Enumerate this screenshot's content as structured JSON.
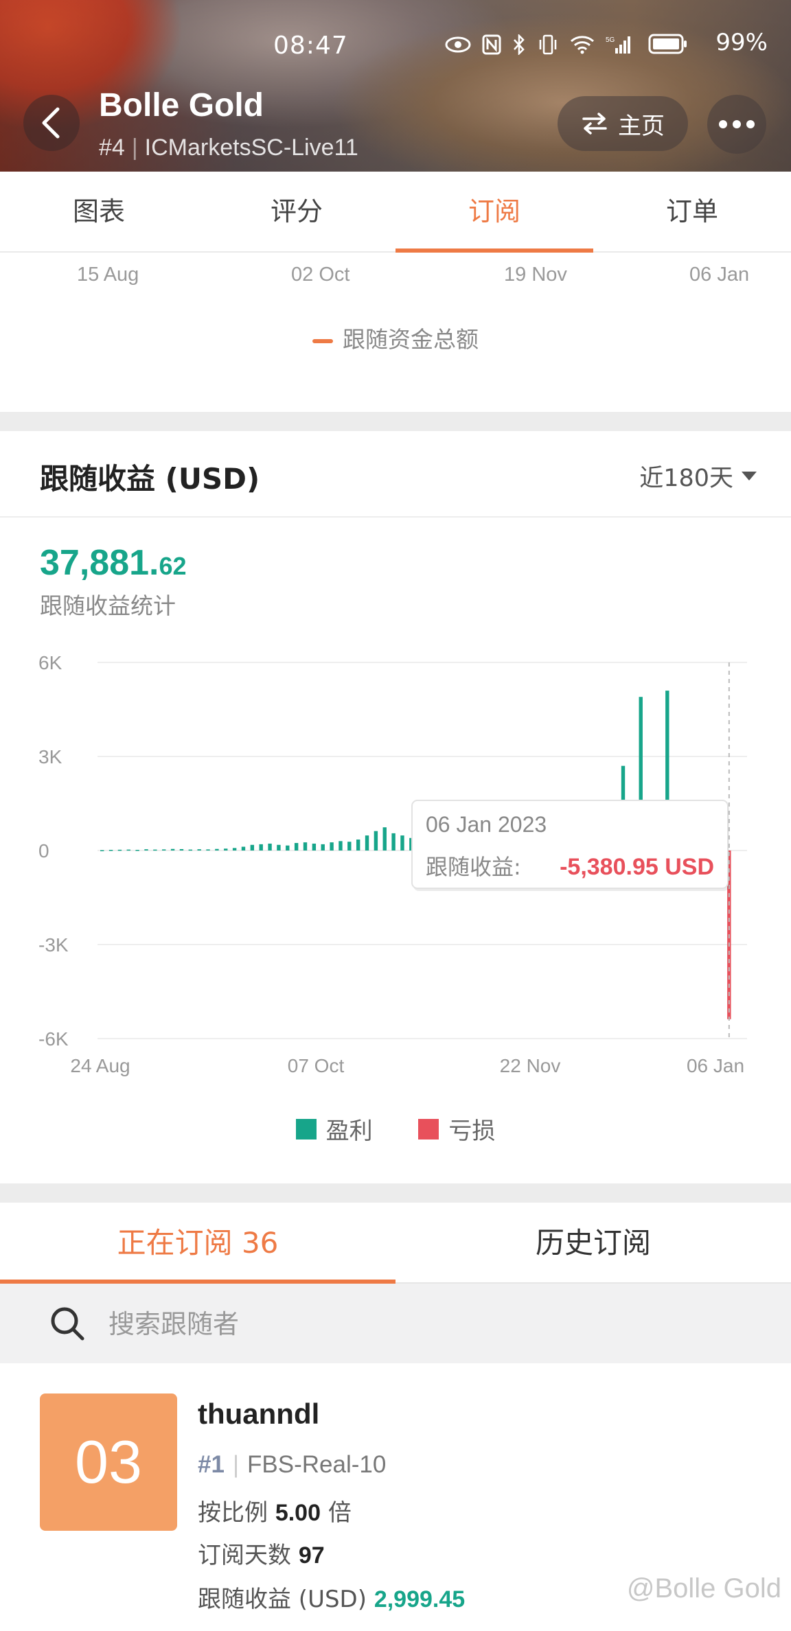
{
  "status_bar": {
    "time": "08:47",
    "battery": "99%",
    "network": "5G"
  },
  "header": {
    "title": "Bolle Gold",
    "rank": "#4",
    "server": "ICMarketsSC-Live11",
    "home_label": "主页"
  },
  "top_tabs": [
    "图表",
    "评分",
    "订阅",
    "订单"
  ],
  "top_tabs_active": "订阅",
  "previous_chart": {
    "x_ticks": [
      "15 Aug",
      "02 Oct",
      "19 Nov",
      "06 Jan"
    ],
    "legend": "跟随资金总额"
  },
  "profit_section": {
    "title": "跟随收益 (USD)",
    "range": "近180天",
    "value_int": "37,881.",
    "value_dec": "62",
    "value_label": "跟随收益统计",
    "tooltip": {
      "date": "06 Jan 2023",
      "label": "跟随收益:",
      "value": "-5,380.95 USD"
    },
    "legend": {
      "profit": "盈利",
      "loss": "亏损"
    }
  },
  "chart_data": {
    "type": "bar",
    "ylim": [
      -6000,
      6000
    ],
    "y_ticks": [
      "6K",
      "3K",
      "0",
      "-3K",
      "-6K"
    ],
    "x_ticks": [
      "24 Aug",
      "07 Oct",
      "22 Nov",
      "06 Jan"
    ],
    "series": [
      {
        "name": "盈利",
        "color": "#17a58a",
        "values": [
          10,
          20,
          25,
          30,
          20,
          40,
          30,
          35,
          50,
          45,
          30,
          40,
          35,
          50,
          60,
          80,
          120,
          180,
          200,
          220,
          180,
          160,
          240,
          260,
          220,
          200,
          260,
          300,
          280,
          350,
          480,
          620,
          740,
          550,
          480,
          400,
          380,
          420,
          460,
          500,
          440,
          520,
          560,
          600,
          500,
          450,
          520,
          580,
          620,
          680,
          600,
          550,
          700,
          760,
          820,
          680,
          900,
          1200,
          1000,
          2700,
          1400,
          4900,
          600,
          400,
          5100,
          600,
          800,
          400,
          900,
          1100,
          800
        ]
      },
      {
        "name": "亏损",
        "color": "#e8505b",
        "values": [
          -5380.95
        ]
      }
    ],
    "colors": {
      "profit": "#17a58a",
      "loss": "#e8505b"
    }
  },
  "subscription_tabs": {
    "active": "正在订阅 36",
    "history": "历史订阅"
  },
  "search": {
    "placeholder": "搜索跟随者"
  },
  "follower": {
    "rank_badge": "03",
    "name": "thuanndl",
    "rank": "#1",
    "server": "FBS-Real-10",
    "ratio_label": "按比例",
    "ratio_value": "5.00",
    "ratio_unit": "倍",
    "days_label": "订阅天数",
    "days_value": "97",
    "profit_label": "跟随收益 (USD)",
    "profit_value": "2,999.45"
  },
  "watermark": "@Bolle Gold",
  "colors": {
    "accent": "#ee7a45",
    "profit": "#17a58a",
    "loss": "#e8505b"
  }
}
